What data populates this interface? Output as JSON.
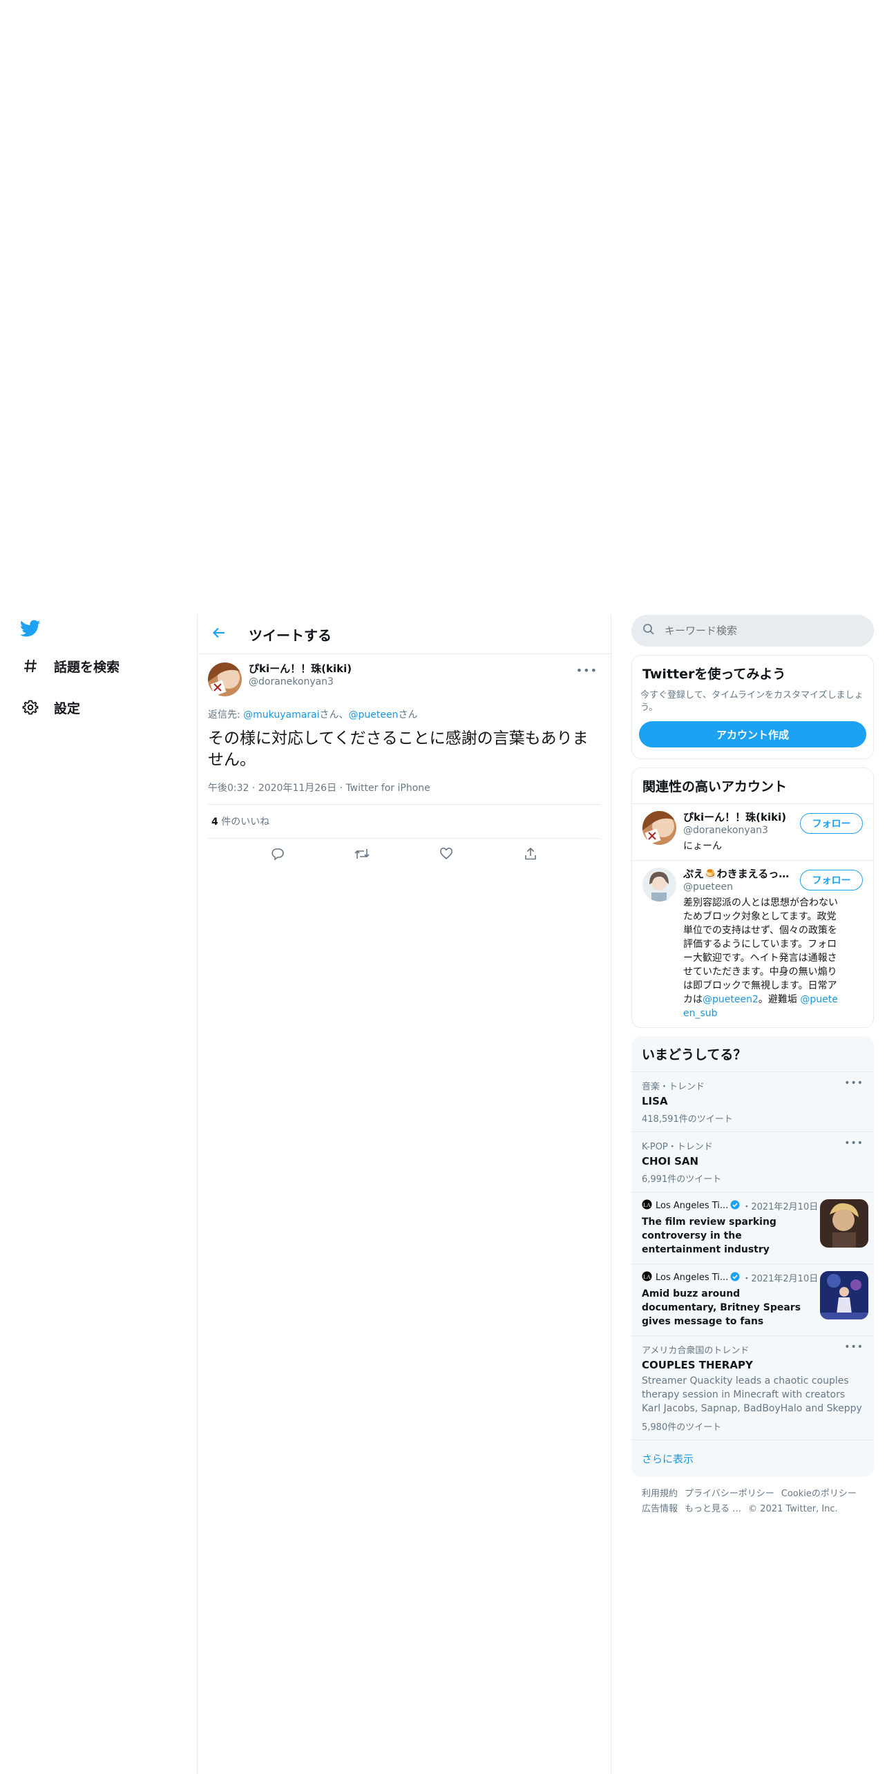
{
  "colors": {
    "brand": "#1da1f2",
    "link": "#1b95e0",
    "muted": "#657786",
    "border": "#e6ecf0"
  },
  "nav": {
    "logo_icon": "twitter-bird-icon",
    "explore_label": "話題を検索",
    "settings_label": "設定"
  },
  "header": {
    "title": "ツイートする"
  },
  "tweet": {
    "author_name": "ぴkiーん！！珠(kiki)",
    "author_handle": "@doranekonyan3",
    "reply_prefix": "返信先: ",
    "reply_user1": "@mukuyamarai",
    "reply_sep": "さん、",
    "reply_user2": "@pueteen",
    "reply_suffix": "さん",
    "text": "その様に対応してくださることに感謝の言葉もありません。",
    "time": "午後0:32",
    "date": "2020年11月26日",
    "client": "Twitter for iPhone",
    "likes_count": "4",
    "likes_label": " 件のいいね"
  },
  "search": {
    "placeholder": "キーワード検索"
  },
  "signup": {
    "title": "Twitterを使ってみよう",
    "desc": "今すぐ登録して、タイムラインをカスタマイズしましょう。",
    "button": "アカウント作成"
  },
  "related": {
    "title": "関連性の高いアカウント",
    "accounts": [
      {
        "name": "ぴkiーん！！珠(kiki)",
        "handle": "@doranekonyan3",
        "bio": "にょーん",
        "follow": "フォロー"
      },
      {
        "name": "ぷえ🍮わきまえるっ…",
        "handle": "@pueteen",
        "bio": "差別容認派の人とは思想が合わないためブロック対象としてます。政党単位での支持はせず、個々の政策を評価するようにしています。フォロー大歓迎です。ヘイト発言は通報させていただきます。中身の無い煽りは即ブロックで無視します。日常アカは",
        "bio_link1": "@pueteen2",
        "bio_mid": "。避難垢 ",
        "bio_link2": "@pueteen_sub",
        "follow": "フォロー"
      }
    ]
  },
  "trends": {
    "title": "いまどうしてる？",
    "items": [
      {
        "context": "音楽・トレンド",
        "name": "LISA",
        "count": "418,591件のツイート"
      },
      {
        "context": "K-POP・トレンド",
        "name": "CHOI SAN",
        "count": "6,991件のツイート"
      }
    ],
    "news": [
      {
        "source": "Los Angeles Ti...",
        "date": "・2021年2月10日",
        "headline": "The film review sparking controversy in the entertainment industry"
      },
      {
        "source": "Los Angeles Ti...",
        "date": "・2021年2月10日",
        "headline": "Amid buzz around documentary, Britney Spears gives message to fans"
      }
    ],
    "region_trend": {
      "context": "アメリカ合衆国のトレンド",
      "name": "COUPLES THERAPY",
      "desc": "Streamer Quackity leads a chaotic couples therapy session in Minecraft with creators Karl Jacobs, Sapnap, BadBoyHalo and Skeppy",
      "count": "5,980件のツイート"
    },
    "show_more": "さらに表示"
  },
  "footer": {
    "terms": "利用規約",
    "privacy": "プライバシーポリシー",
    "cookie": "Cookieのポリシー",
    "ads": "広告情報",
    "more": "もっと見る …",
    "copyright": "© 2021 Twitter, Inc."
  }
}
